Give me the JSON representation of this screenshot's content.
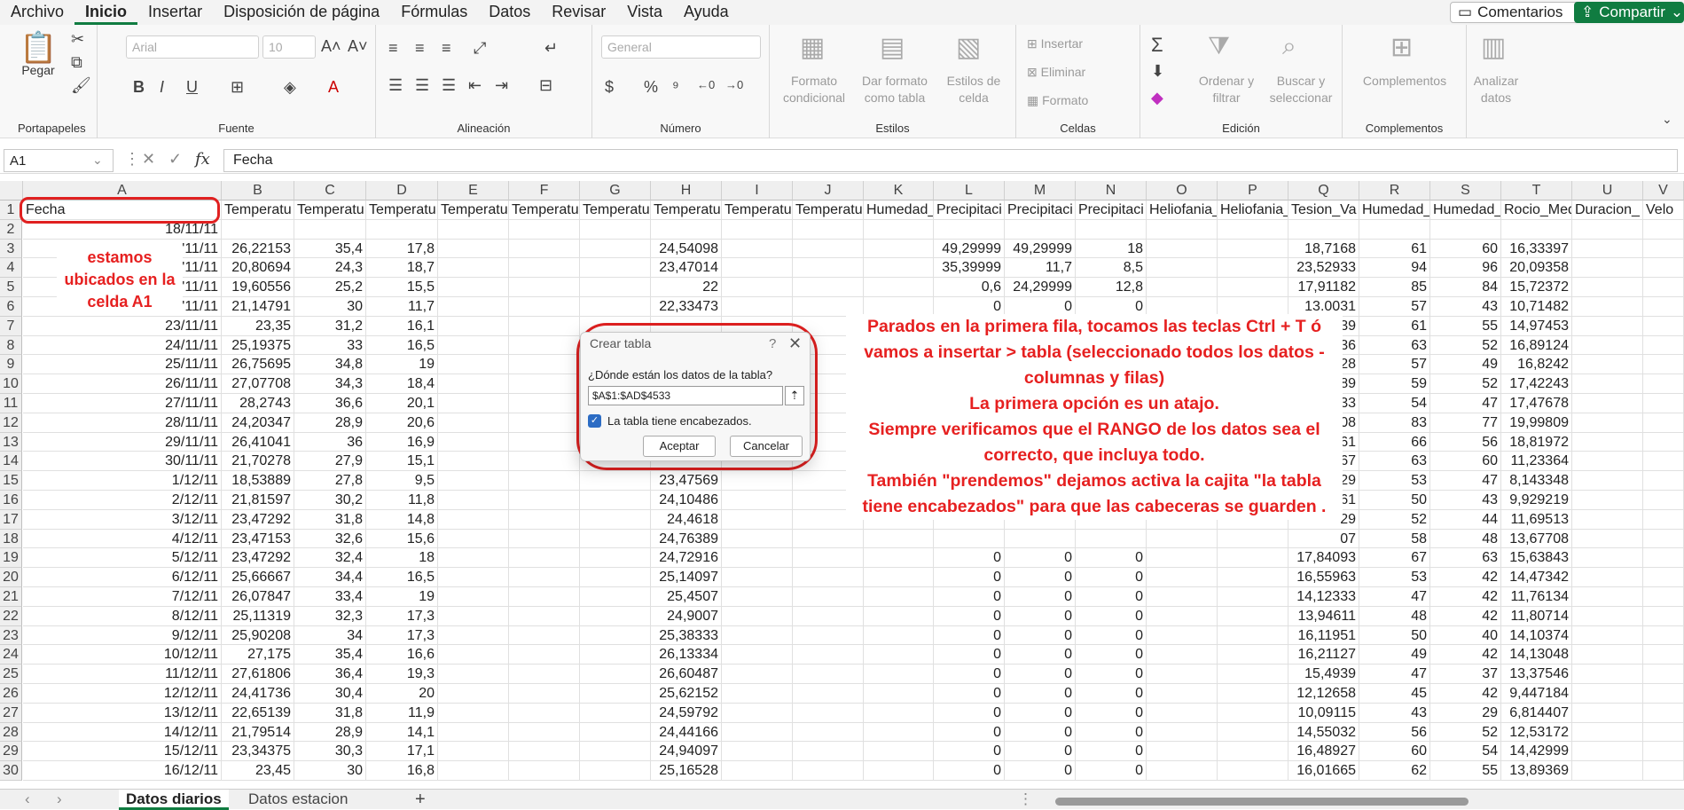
{
  "menu": [
    "Archivo",
    "Inicio",
    "Insertar",
    "Disposición de página",
    "Fórmulas",
    "Datos",
    "Revisar",
    "Vista",
    "Ayuda"
  ],
  "menu_active": "Inicio",
  "topbar": {
    "comentarios": "Comentarios",
    "compartir": "Compartir"
  },
  "ribbon": {
    "paste_label": "Pegar",
    "font_name": "Arial",
    "font_size": "10",
    "number_format": "General",
    "groups": {
      "portapapeles": "Portapapeles",
      "fuente": "Fuente",
      "alineacion": "Alineación",
      "numero": "Número",
      "estilos": "Estilos",
      "celdas": "Celdas",
      "edicion": "Edición",
      "complementos": "Complementos"
    },
    "estilos_btns": [
      "Formato condicional",
      "Dar formato como tabla",
      "Estilos de celda"
    ],
    "celdas_btns": [
      "Insertar",
      "Eliminar",
      "Formato"
    ],
    "edicion_btns": [
      "Ordenar y filtrar",
      "Buscar y seleccionar"
    ],
    "complementos_btn": "Complementos",
    "analizar_btn": "Analizar datos"
  },
  "formula_bar": {
    "name_box": "A1",
    "fx": "fx",
    "value": "Fecha"
  },
  "columns": [
    "A",
    "B",
    "C",
    "D",
    "E",
    "F",
    "G",
    "H",
    "I",
    "J",
    "K",
    "L",
    "M",
    "N",
    "O",
    "P",
    "Q",
    "R",
    "S",
    "T",
    "U",
    "V"
  ],
  "headers": [
    "Fecha",
    "Temperatu",
    "Temperatu",
    "Temperatu",
    "Temperatu",
    "Temperatu",
    "Temperatu",
    "Temperatu",
    "Temperatu",
    "Temperatu",
    "Humedad_",
    "Precipitaci",
    "Precipitaci",
    "Precipitaci",
    "Heliofania_",
    "Heliofania_",
    "Tesion_Va",
    "Humedad_",
    "Humedad_",
    "Rocio_Med",
    "Duracion_",
    "Velo"
  ],
  "rows": [
    [
      "18/11/11",
      "",
      "",
      "",
      "",
      "",
      "",
      "",
      "",
      "",
      "",
      "",
      "",
      "",
      "",
      "",
      "",
      "",
      "",
      "",
      "",
      ""
    ],
    [
      "'11/11",
      "26,22153",
      "35,4",
      "17,8",
      "",
      "",
      "",
      "24,54098",
      "",
      "",
      "",
      "49,29999",
      "49,29999",
      "18",
      "",
      "",
      "18,7168",
      "61",
      "60",
      "16,33397",
      "",
      ""
    ],
    [
      "'11/11",
      "20,80694",
      "24,3",
      "18,7",
      "",
      "",
      "",
      "23,47014",
      "",
      "",
      "",
      "35,39999",
      "11,7",
      "8,5",
      "",
      "",
      "23,52933",
      "94",
      "96",
      "20,09358",
      "",
      ""
    ],
    [
      "'11/11",
      "19,60556",
      "25,2",
      "15,5",
      "",
      "",
      "",
      "22",
      "",
      "",
      "",
      "0,6",
      "24,29999",
      "12,8",
      "",
      "",
      "17,91182",
      "85",
      "84",
      "15,72372",
      "",
      ""
    ],
    [
      "'11/11",
      "21,14791",
      "30",
      "11,7",
      "",
      "",
      "",
      "22,33473",
      "",
      "",
      "",
      "0",
      "0",
      "0",
      "",
      "",
      "13.0031",
      "57",
      "43",
      "10,71482",
      "",
      ""
    ],
    [
      "23/11/11",
      "23,35",
      "31,2",
      "16,1",
      "",
      "",
      "",
      "",
      "",
      "",
      "",
      "",
      "",
      "",
      "",
      "",
      "39",
      "61",
      "55",
      "14,97453",
      "",
      ""
    ],
    [
      "24/11/11",
      "25,19375",
      "33",
      "16,5",
      "",
      "",
      "",
      "",
      "",
      "",
      "",
      "",
      "",
      "",
      "",
      "",
      "36",
      "63",
      "52",
      "16,89124",
      "",
      ""
    ],
    [
      "25/11/11",
      "26,75695",
      "34,8",
      "19",
      "",
      "",
      "",
      "",
      "",
      "",
      "",
      "",
      "",
      "",
      "",
      "",
      "28",
      "57",
      "49",
      "16,8242",
      "",
      ""
    ],
    [
      "26/11/11",
      "27,07708",
      "34,3",
      "18,4",
      "",
      "",
      "",
      "",
      "",
      "",
      "",
      "",
      "",
      "",
      "",
      "",
      "89",
      "59",
      "52",
      "17,42243",
      "",
      ""
    ],
    [
      "27/11/11",
      "28,2743",
      "36,6",
      "20,1",
      "",
      "",
      "",
      "",
      "",
      "",
      "",
      "",
      "",
      "",
      "",
      "",
      "33",
      "54",
      "47",
      "17,47678",
      "",
      ""
    ],
    [
      "28/11/11",
      "24,20347",
      "28,9",
      "20,6",
      "",
      "",
      "",
      "",
      "",
      "",
      "",
      "",
      "",
      "",
      "",
      "",
      "08",
      "83",
      "77",
      "19,99809",
      "",
      ""
    ],
    [
      "29/11/11",
      "26,41041",
      "36",
      "16,9",
      "",
      "",
      "",
      "",
      "",
      "",
      "",
      "",
      "",
      "",
      "",
      "",
      "61",
      "66",
      "56",
      "18,81972",
      "",
      ""
    ],
    [
      "30/11/11",
      "21,70278",
      "27,9",
      "15,1",
      "",
      "",
      "",
      "",
      "",
      "",
      "",
      "",
      "",
      "",
      "",
      "",
      "67",
      "63",
      "60",
      "11,23364",
      "",
      ""
    ],
    [
      "1/12/11",
      "18,53889",
      "27,8",
      "9,5",
      "",
      "",
      "",
      "23,47569",
      "",
      "",
      "",
      "",
      "",
      "",
      "",
      "",
      "29",
      "53",
      "47",
      "8,143348",
      "",
      ""
    ],
    [
      "2/12/11",
      "21,81597",
      "30,2",
      "11,8",
      "",
      "",
      "",
      "24,10486",
      "",
      "",
      "",
      "",
      "",
      "",
      "",
      "",
      "61",
      "50",
      "43",
      "9,929219",
      "",
      ""
    ],
    [
      "3/12/11",
      "23,47292",
      "31,8",
      "14,8",
      "",
      "",
      "",
      "24,4618",
      "",
      "",
      "",
      "",
      "",
      "",
      "",
      "",
      "29",
      "52",
      "44",
      "11,69513",
      "",
      ""
    ],
    [
      "4/12/11",
      "23,47153",
      "32,6",
      "15,6",
      "",
      "",
      "",
      "24,76389",
      "",
      "",
      "",
      "",
      "",
      "",
      "",
      "",
      "07",
      "58",
      "48",
      "13,67708",
      "",
      ""
    ],
    [
      "5/12/11",
      "23,47292",
      "32,4",
      "18",
      "",
      "",
      "",
      "24,72916",
      "",
      "",
      "",
      "0",
      "0",
      "0",
      "",
      "",
      "17,84093",
      "67",
      "63",
      "15,63843",
      "",
      ""
    ],
    [
      "6/12/11",
      "25,66667",
      "34,4",
      "16,5",
      "",
      "",
      "",
      "25,14097",
      "",
      "",
      "",
      "0",
      "0",
      "0",
      "",
      "",
      "16,55963",
      "53",
      "42",
      "14,47342",
      "",
      ""
    ],
    [
      "7/12/11",
      "26,07847",
      "33,4",
      "19",
      "",
      "",
      "",
      "25,4507",
      "",
      "",
      "",
      "0",
      "0",
      "0",
      "",
      "",
      "14,12333",
      "47",
      "42",
      "11,76134",
      "",
      ""
    ],
    [
      "8/12/11",
      "25,11319",
      "32,3",
      "17,3",
      "",
      "",
      "",
      "24,9007",
      "",
      "",
      "",
      "0",
      "0",
      "0",
      "",
      "",
      "13,94611",
      "48",
      "42",
      "11,80714",
      "",
      ""
    ],
    [
      "9/12/11",
      "25,90208",
      "34",
      "17,3",
      "",
      "",
      "",
      "25,38333",
      "",
      "",
      "",
      "0",
      "0",
      "0",
      "",
      "",
      "16,11951",
      "50",
      "40",
      "14,10374",
      "",
      ""
    ],
    [
      "10/12/11",
      "27,175",
      "35,4",
      "16,6",
      "",
      "",
      "",
      "26,13334",
      "",
      "",
      "",
      "0",
      "0",
      "0",
      "",
      "",
      "16,21127",
      "49",
      "42",
      "14,13048",
      "",
      ""
    ],
    [
      "11/12/11",
      "27,61806",
      "36,4",
      "19,3",
      "",
      "",
      "",
      "26,60487",
      "",
      "",
      "",
      "0",
      "0",
      "0",
      "",
      "",
      "15,4939",
      "47",
      "37",
      "13,37546",
      "",
      ""
    ],
    [
      "12/12/11",
      "24,41736",
      "30,4",
      "20",
      "",
      "",
      "",
      "25,62152",
      "",
      "",
      "",
      "0",
      "0",
      "0",
      "",
      "",
      "12,12658",
      "45",
      "42",
      "9,447184",
      "",
      ""
    ],
    [
      "13/12/11",
      "22,65139",
      "31,8",
      "11,9",
      "",
      "",
      "",
      "24,59792",
      "",
      "",
      "",
      "0",
      "0",
      "0",
      "",
      "",
      "10,09115",
      "43",
      "29",
      "6,814407",
      "",
      ""
    ],
    [
      "14/12/11",
      "21,79514",
      "28,9",
      "14,1",
      "",
      "",
      "",
      "24,44166",
      "",
      "",
      "",
      "0",
      "0",
      "0",
      "",
      "",
      "14,55032",
      "56",
      "52",
      "12,53172",
      "",
      ""
    ],
    [
      "15/12/11",
      "23,34375",
      "30,3",
      "17,1",
      "",
      "",
      "",
      "24,94097",
      "",
      "",
      "",
      "0",
      "0",
      "0",
      "",
      "",
      "16,48927",
      "60",
      "54",
      "14,42999",
      "",
      ""
    ],
    [
      "16/12/11",
      "23,45",
      "30",
      "16,8",
      "",
      "",
      "",
      "25,16528",
      "",
      "",
      "",
      "0",
      "0",
      "0",
      "",
      "",
      "16,01665",
      "62",
      "55",
      "13,89369",
      "",
      ""
    ]
  ],
  "dialog": {
    "title": "Crear tabla",
    "help": "?",
    "close": "✕",
    "question": "¿Dónde están los datos de la tabla?",
    "range": "$A$1:$AD$4533",
    "checkbox_label": "La tabla tiene encabezados.",
    "checkbox_checked": true,
    "accept": "Aceptar",
    "cancel": "Cancelar"
  },
  "annotations": {
    "left": "estamos ubicados en la celda A1",
    "right": "Parados en la primera fila, tocamos las teclas Ctrl + T ó vamos a insertar > tabla (seleccionado todos los datos - columnas y filas)\nLa primera opción es un atajo.\nSiempre verificamos que el RANGO  de los datos sea el correcto, que incluya todo.\nTambién \"prendemos\" dejamos activa la cajita \"la tabla tiene encabezados\" para que las cabeceras se guarden ."
  },
  "sheet_tabs": [
    "Datos diarios",
    "Datos estacion"
  ],
  "active_tab": "Datos diarios",
  "add_sheet": "+",
  "colors": {
    "accent": "#107c41",
    "annotation": "#e62020",
    "checkbox": "#2c6cc4"
  }
}
